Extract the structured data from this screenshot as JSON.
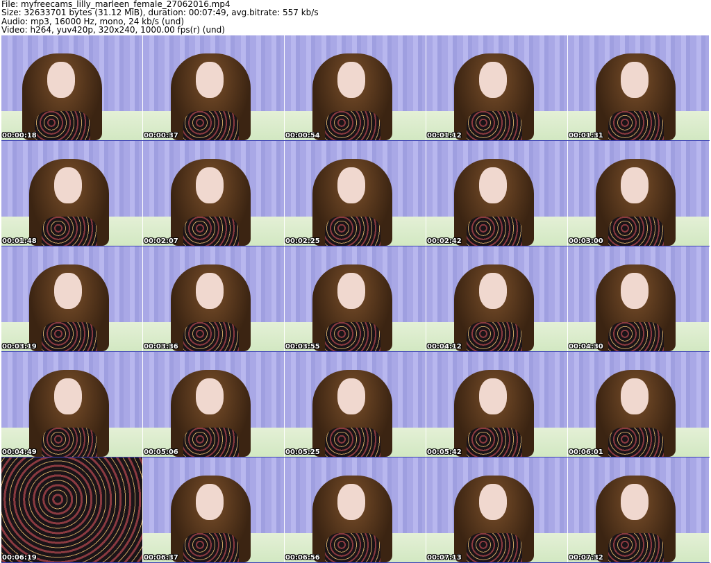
{
  "header": {
    "file": "File: myfreecams_lilly_marleen_female_27062016.mp4",
    "size": "Size: 32633701 bytes (31.12 MiB), duration: 00:07:49, avg.bitrate: 557 kb/s",
    "audio": "Audio: mp3, 16000 Hz, mono, 24 kb/s (und)",
    "video": "Video: h264, yuv420p, 320x240, 1000.00 fps(r) (und)"
  },
  "thumbnails": [
    [
      "00:00:18",
      "00:00:37",
      "00:00:54",
      "00:01:12",
      "00:01:31"
    ],
    [
      "00:01:48",
      "00:02:07",
      "00:02:25",
      "00:02:42",
      "00:03:00"
    ],
    [
      "00:03:19",
      "00:03:36",
      "00:03:55",
      "00:04:12",
      "00:04:30"
    ],
    [
      "00:04:49",
      "00:05:06",
      "00:05:25",
      "00:05:42",
      "00:06:01"
    ],
    [
      "00:06:19",
      "00:06:37",
      "00:06:56",
      "00:07:13",
      "00:07:32"
    ]
  ]
}
